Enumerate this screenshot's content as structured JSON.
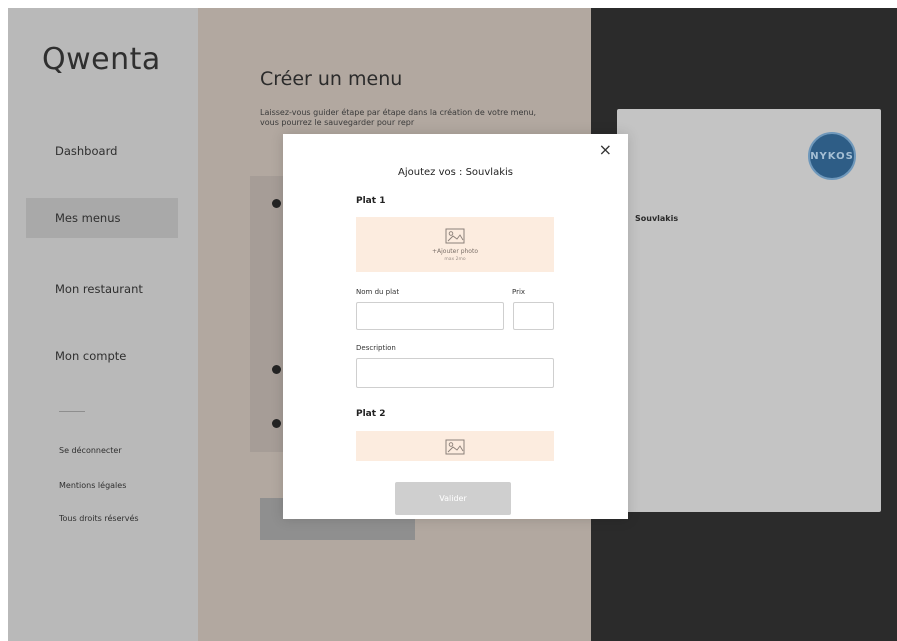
{
  "sidebar": {
    "logo": "Qwenta",
    "items": [
      {
        "label": "Dashboard"
      },
      {
        "label": "Mes menus"
      },
      {
        "label": "Mon restaurant"
      },
      {
        "label": "Mon compte"
      }
    ],
    "footer_links": [
      {
        "label": "Se déconnecter"
      },
      {
        "label": "Mentions légales"
      },
      {
        "label": "Tous droits réservés"
      }
    ]
  },
  "main": {
    "title": "Créer un menu",
    "description": "Laissez-vous guider étape par étape dans la création de votre menu, vous pourrez le sauvegarder pour repr"
  },
  "preview": {
    "brand": "NYKOS",
    "category": "Souvlakis"
  },
  "modal": {
    "title": "Ajoutez vos : Souvlakis",
    "close_icon": "×",
    "plat1": {
      "label": "Plat 1",
      "photo_label": "+Ajouter photo",
      "photo_sub": "max 2mo",
      "name_label": "Nom du plat",
      "price_label": "Prix",
      "description_label": "Description"
    },
    "plat2": {
      "label": "Plat 2"
    },
    "submit_label": "Valider"
  },
  "icons": {
    "photo": "image-placeholder-icon",
    "close": "close-icon"
  }
}
